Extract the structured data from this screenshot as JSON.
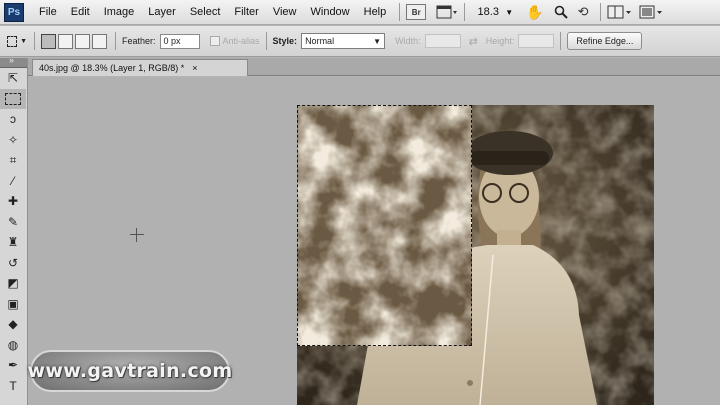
{
  "app": {
    "logo_text": "Ps",
    "menus": [
      "File",
      "Edit",
      "Image",
      "Layer",
      "Select",
      "Filter",
      "View",
      "Window",
      "Help"
    ],
    "bridge_label": "Br",
    "zoom_level": "18.3"
  },
  "options": {
    "feather_label": "Feather:",
    "feather_value": "0 px",
    "antialias_label": "Anti-alias",
    "style_label": "Style:",
    "style_value": "Normal",
    "width_label": "Width:",
    "height_label": "Height:",
    "refine_edge_label": "Refine Edge..."
  },
  "document": {
    "tab_title": "40s.jpg @ 18.3% (Layer 1, RGB/8) *",
    "close_glyph": "×"
  },
  "tools": [
    {
      "name": "move-icon",
      "glyph": "⇱"
    },
    {
      "name": "rectangular-marquee-icon",
      "glyph": ""
    },
    {
      "name": "lasso-icon",
      "glyph": "ↄ"
    },
    {
      "name": "magic-wand-icon",
      "glyph": "✧"
    },
    {
      "name": "crop-icon",
      "glyph": "⌗"
    },
    {
      "name": "eyedropper-icon",
      "glyph": "⁄"
    },
    {
      "name": "healing-brush-icon",
      "glyph": "✚"
    },
    {
      "name": "brush-icon",
      "glyph": "✎"
    },
    {
      "name": "clone-stamp-icon",
      "glyph": "♜"
    },
    {
      "name": "history-brush-icon",
      "glyph": "↺"
    },
    {
      "name": "eraser-icon",
      "glyph": "◩"
    },
    {
      "name": "gradient-icon",
      "glyph": "▣"
    },
    {
      "name": "blur-icon",
      "glyph": "◆"
    },
    {
      "name": "dodge-icon",
      "glyph": "◍"
    },
    {
      "name": "pen-icon",
      "glyph": "✒"
    },
    {
      "name": "type-icon",
      "glyph": "T"
    }
  ],
  "watermark": "www.gavtrain.com",
  "colors": {
    "accent": "#1a3c6e",
    "canvas_bg": "#b1b1b1",
    "sepia_dark": "#3e3325",
    "sepia_light": "#d9ccb2"
  }
}
